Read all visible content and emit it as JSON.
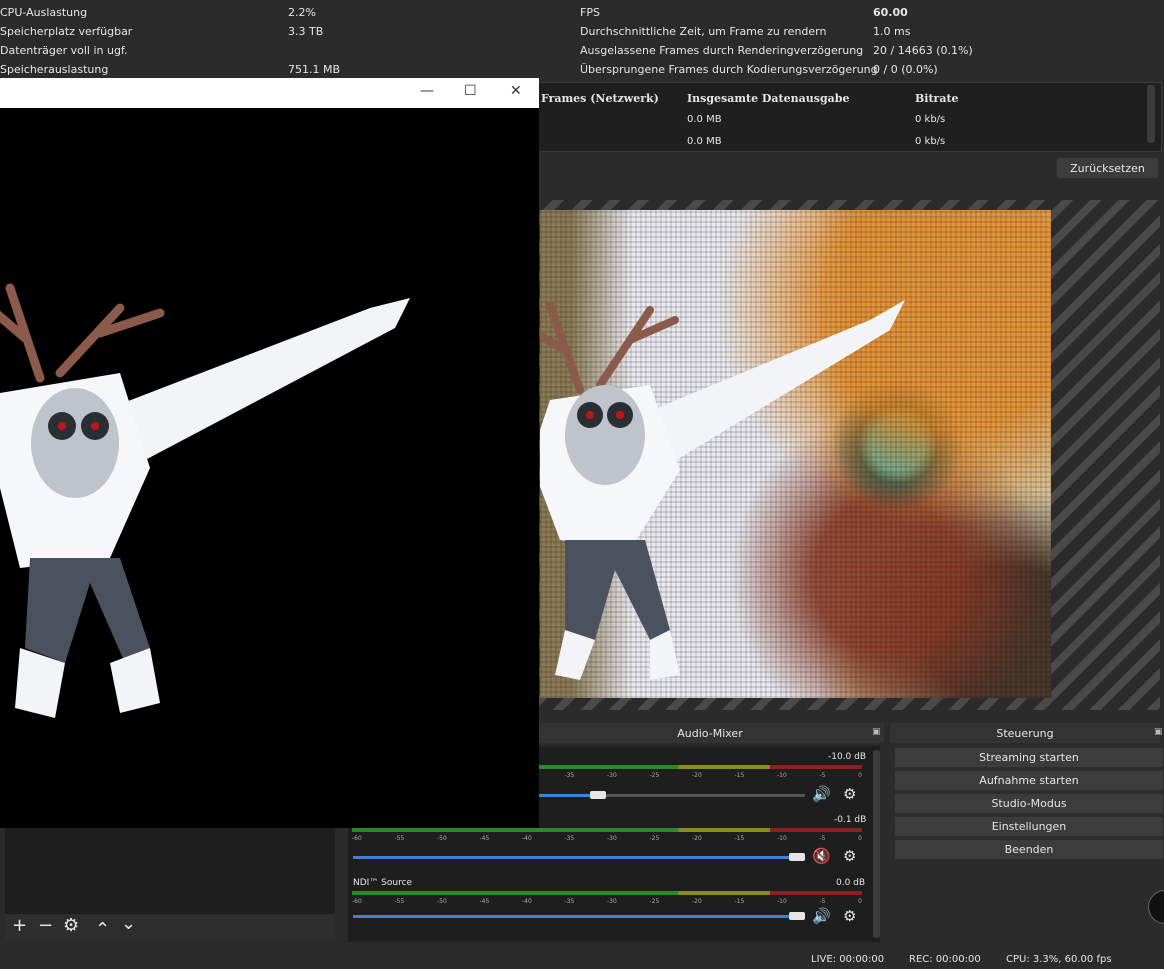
{
  "stats_left": [
    {
      "label": "CPU-Auslastung",
      "value": "2.2%"
    },
    {
      "label": "Speicherplatz verfügbar",
      "value": "3.3 TB"
    },
    {
      "label": "Datenträger voll in ugf.",
      "value": ""
    },
    {
      "label": "Speicherauslastung",
      "value": "751.1 MB"
    }
  ],
  "stats_right": [
    {
      "label": "FPS",
      "value": "60.00"
    },
    {
      "label": "Durchschnittliche Zeit, um Frame zu rendern",
      "value": "1.0 ms"
    },
    {
      "label": "Ausgelassene Frames durch Renderingverzögerung",
      "value": "20 / 14663 (0.1%)"
    },
    {
      "label": "Übersprungene Frames durch Kodierungsverzögerung",
      "value": "0 / 0 (0.0%)"
    }
  ],
  "network": {
    "headers": [
      "Frames (Netzwerk)",
      "Insgesamte Datenausgabe",
      "Bitrate"
    ],
    "rows": [
      {
        "frames": "",
        "data": "0.0 MB",
        "bitrate": "0 kb/s"
      },
      {
        "frames": "",
        "data": "0.0 MB",
        "bitrate": "0 kb/s"
      }
    ]
  },
  "reset_label": "Zurücksetzen",
  "docks": {
    "audio_mixer": "Audio-Mixer",
    "controls": "Steuerung"
  },
  "mixer": {
    "ticks": [
      "-60",
      "-55",
      "-50",
      "-45",
      "-40",
      "-35",
      "-30",
      "-25",
      "-20",
      "-15",
      "-10",
      "-5",
      "0"
    ],
    "channels": [
      {
        "name": "",
        "db": "-10.0 dB",
        "volume": 0.56,
        "muted": false
      },
      {
        "name": "",
        "db": "-0.1 dB",
        "volume": 1.0,
        "muted": true
      },
      {
        "name": "NDI™ Source",
        "db": "0.0 dB",
        "volume": 1.0,
        "muted": false
      }
    ]
  },
  "controls": [
    "Streaming starten",
    "Aufnahme starten",
    "Studio-Modus",
    "Einstellungen",
    "Beenden"
  ],
  "status": {
    "live": "LIVE: 00:00:00",
    "rec": "REC: 00:00:00",
    "cpu": "CPU: 3.3%, 60.00 fps"
  },
  "icons": {
    "add": "+",
    "remove": "−",
    "settings": "⚙",
    "up": "⌃",
    "down": "⌄",
    "speaker": "🔊",
    "muted": "🔇"
  }
}
